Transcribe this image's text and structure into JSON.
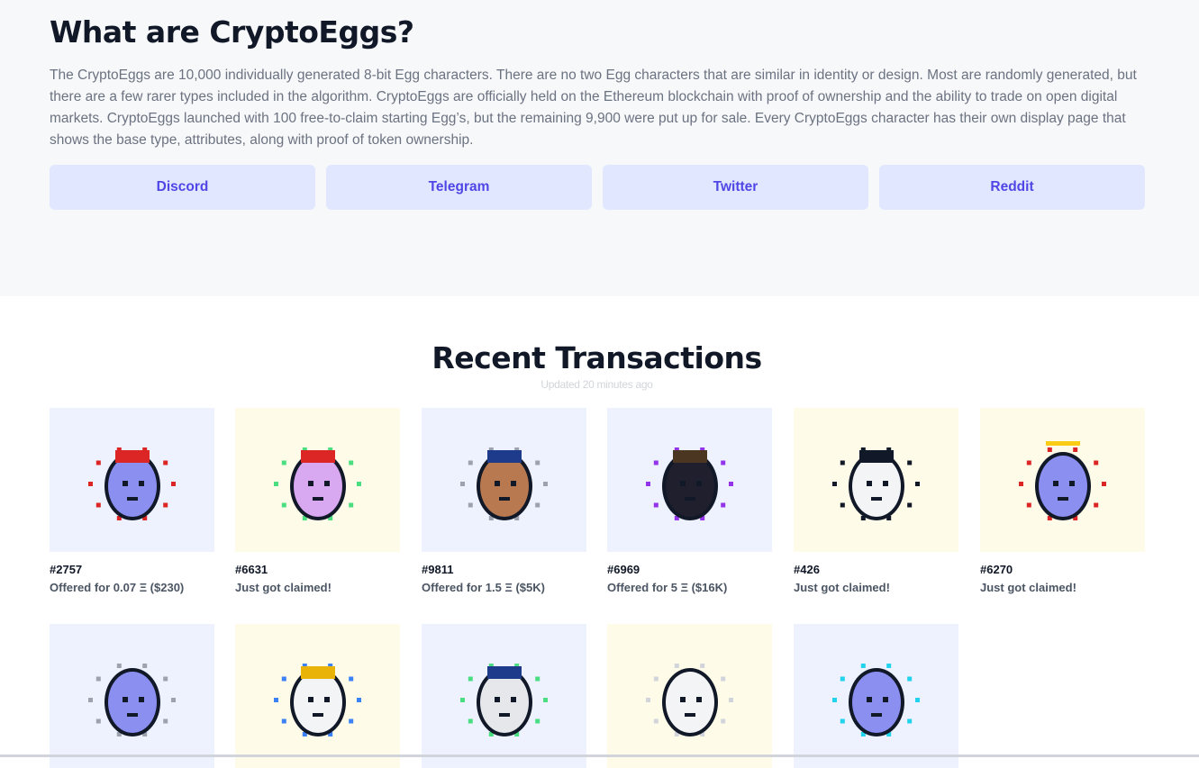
{
  "about": {
    "title": "What are CryptoEggs?",
    "description": "The CryptoEggs are 10,000 individually generated 8-bit Egg characters. There are no two Egg characters that are similar in identity or design. Most are randomly generated, but there are a few rarer types included in the algorithm. CryptoEggs are officially held on the Ethereum blockchain with proof of ownership and the ability to trade on open digital markets. CryptoEggs launched with 100 free-to-claim starting Egg’s, but the remaining 9,900 were put up for sale. Every CryptoEggs character has their own display page that shows the base type, attributes, along with proof of token ownership.",
    "links": [
      "Discord",
      "Telegram",
      "Twitter",
      "Reddit"
    ]
  },
  "recent": {
    "title": "Recent Transactions",
    "updated": "Updated 20 minutes ago"
  },
  "transactions": [
    {
      "id": "#2757",
      "status": "Offered for 0.07 Ξ ($230)",
      "bg": "blue",
      "body": "#8a8ff0",
      "hat": "santa",
      "accent": "#dc2626"
    },
    {
      "id": "#6631",
      "status": "Just got claimed!",
      "bg": "cream",
      "body": "#d8a8f0",
      "hat": "santa",
      "accent": "#4ade80"
    },
    {
      "id": "#9811",
      "status": "Offered for 1.5 Ξ ($5K)",
      "bg": "blue",
      "body": "#b87950",
      "hat": "police",
      "accent": "#9ca3af"
    },
    {
      "id": "#6969",
      "status": "Offered for 5 Ξ ($16K)",
      "bg": "blue",
      "body": "#1f1f2e",
      "hat": "cowboy",
      "accent": "#9333ea"
    },
    {
      "id": "#426",
      "status": "Just got claimed!",
      "bg": "cream",
      "body": "#f3f4f6",
      "hat": "bandana",
      "accent": "#111827"
    },
    {
      "id": "#6270",
      "status": "Just got claimed!",
      "bg": "cream",
      "body": "#8a8ff0",
      "hat": "halo",
      "accent": "#dc2626"
    }
  ],
  "transactions_row2": [
    {
      "bg": "blue",
      "body": "#8a8ff0",
      "hat": "none",
      "accent": "#9ca3af"
    },
    {
      "bg": "cream",
      "body": "#f3f4f6",
      "hat": "crown",
      "accent": "#3b82f6"
    },
    {
      "bg": "blue",
      "body": "#e5e7eb",
      "hat": "police",
      "accent": "#4ade80"
    },
    {
      "bg": "cream",
      "body": "#f3f4f6",
      "hat": "none",
      "accent": "#d1d5db"
    },
    {
      "bg": "blue",
      "body": "#8a8ff0",
      "hat": "none",
      "accent": "#22d3ee"
    }
  ]
}
